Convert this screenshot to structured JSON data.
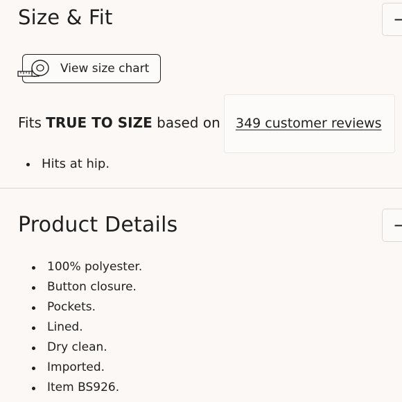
{
  "size_fit": {
    "title": "Size & Fit",
    "toggle_icon": "minus-icon",
    "toggle_glyph": "−",
    "size_chart_label": "View size chart",
    "size_chart_icon": "measuring-tape-icon",
    "fit_prefix": "Fits",
    "fit_value": "TRUE TO SIZE",
    "fit_suffix": "based on",
    "reviews_link": "349 customer reviews",
    "bullets": [
      "Hits at hip."
    ]
  },
  "product_details": {
    "title": "Product Details",
    "toggle_icon": "minus-icon",
    "toggle_glyph": "−",
    "bullets": [
      "100% polyester.",
      "Button closure.",
      "Pockets.",
      "Lined.",
      "Dry clean.",
      "Imported.",
      "Item BS926."
    ]
  },
  "colors": {
    "background": "#fbf8f5",
    "text": "#1f1f1f",
    "border": "#dcd8d3"
  }
}
